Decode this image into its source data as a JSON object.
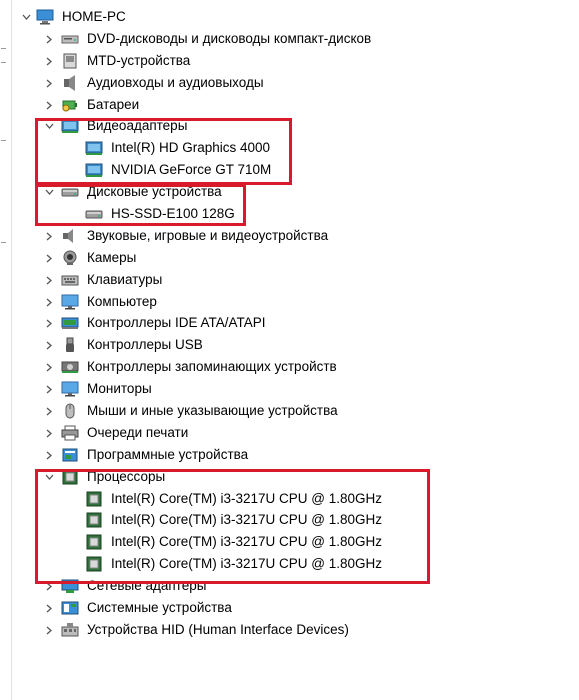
{
  "tree": {
    "root": {
      "label": "HOME-PC",
      "icon": "computer-icon"
    },
    "categories": [
      {
        "label": "DVD-дисководы и дисководы компакт-дисков",
        "icon": "dvd-drive-icon",
        "expanded": false
      },
      {
        "label": "MTD-устройства",
        "icon": "mtd-device-icon",
        "expanded": false
      },
      {
        "label": "Аудиовходы и аудиовыходы",
        "icon": "audio-io-icon",
        "expanded": false
      },
      {
        "label": "Батареи",
        "icon": "battery-icon",
        "expanded": false
      },
      {
        "label": "Видеоадаптеры",
        "icon": "display-adapter-icon",
        "expanded": true,
        "children": [
          {
            "label": "Intel(R) HD Graphics 4000",
            "icon": "display-adapter-icon"
          },
          {
            "label": "NVIDIA GeForce GT 710M",
            "icon": "display-adapter-icon"
          }
        ]
      },
      {
        "label": "Дисковые устройства",
        "icon": "disk-drive-icon",
        "expanded": true,
        "children": [
          {
            "label": "HS-SSD-E100 128G",
            "icon": "disk-drive-icon"
          }
        ]
      },
      {
        "label": "Звуковые, игровые и видеоустройства",
        "icon": "speaker-icon",
        "expanded": false
      },
      {
        "label": "Камеры",
        "icon": "camera-icon",
        "expanded": false
      },
      {
        "label": "Клавиатуры",
        "icon": "keyboard-icon",
        "expanded": false
      },
      {
        "label": "Компьютер",
        "icon": "monitor-icon",
        "expanded": false
      },
      {
        "label": "Контроллеры IDE ATA/ATAPI",
        "icon": "ide-controller-icon",
        "expanded": false
      },
      {
        "label": "Контроллеры USB",
        "icon": "usb-icon",
        "expanded": false
      },
      {
        "label": "Контроллеры запоминающих устройств",
        "icon": "storage-controller-icon",
        "expanded": false
      },
      {
        "label": "Мониторы",
        "icon": "monitor-icon",
        "expanded": false
      },
      {
        "label": "Мыши и иные указывающие устройства",
        "icon": "mouse-icon",
        "expanded": false
      },
      {
        "label": "Очереди печати",
        "icon": "printer-icon",
        "expanded": false
      },
      {
        "label": "Программные устройства",
        "icon": "software-device-icon",
        "expanded": false
      },
      {
        "label": "Процессоры",
        "icon": "processor-icon",
        "expanded": true,
        "children": [
          {
            "label": "Intel(R) Core(TM) i3-3217U CPU @ 1.80GHz",
            "icon": "processor-icon"
          },
          {
            "label": "Intel(R) Core(TM) i3-3217U CPU @ 1.80GHz",
            "icon": "processor-icon"
          },
          {
            "label": "Intel(R) Core(TM) i3-3217U CPU @ 1.80GHz",
            "icon": "processor-icon"
          },
          {
            "label": "Intel(R) Core(TM) i3-3217U CPU @ 1.80GHz",
            "icon": "processor-icon"
          }
        ]
      },
      {
        "label": "Сетевые адаптеры",
        "icon": "network-adapter-icon",
        "expanded": false
      },
      {
        "label": "Системные устройства",
        "icon": "system-device-icon",
        "expanded": false
      },
      {
        "label": "Устройства HID (Human Interface Devices)",
        "icon": "hid-icon",
        "expanded": false
      }
    ]
  },
  "colors": {
    "highlight_border": "#d81b2a"
  }
}
